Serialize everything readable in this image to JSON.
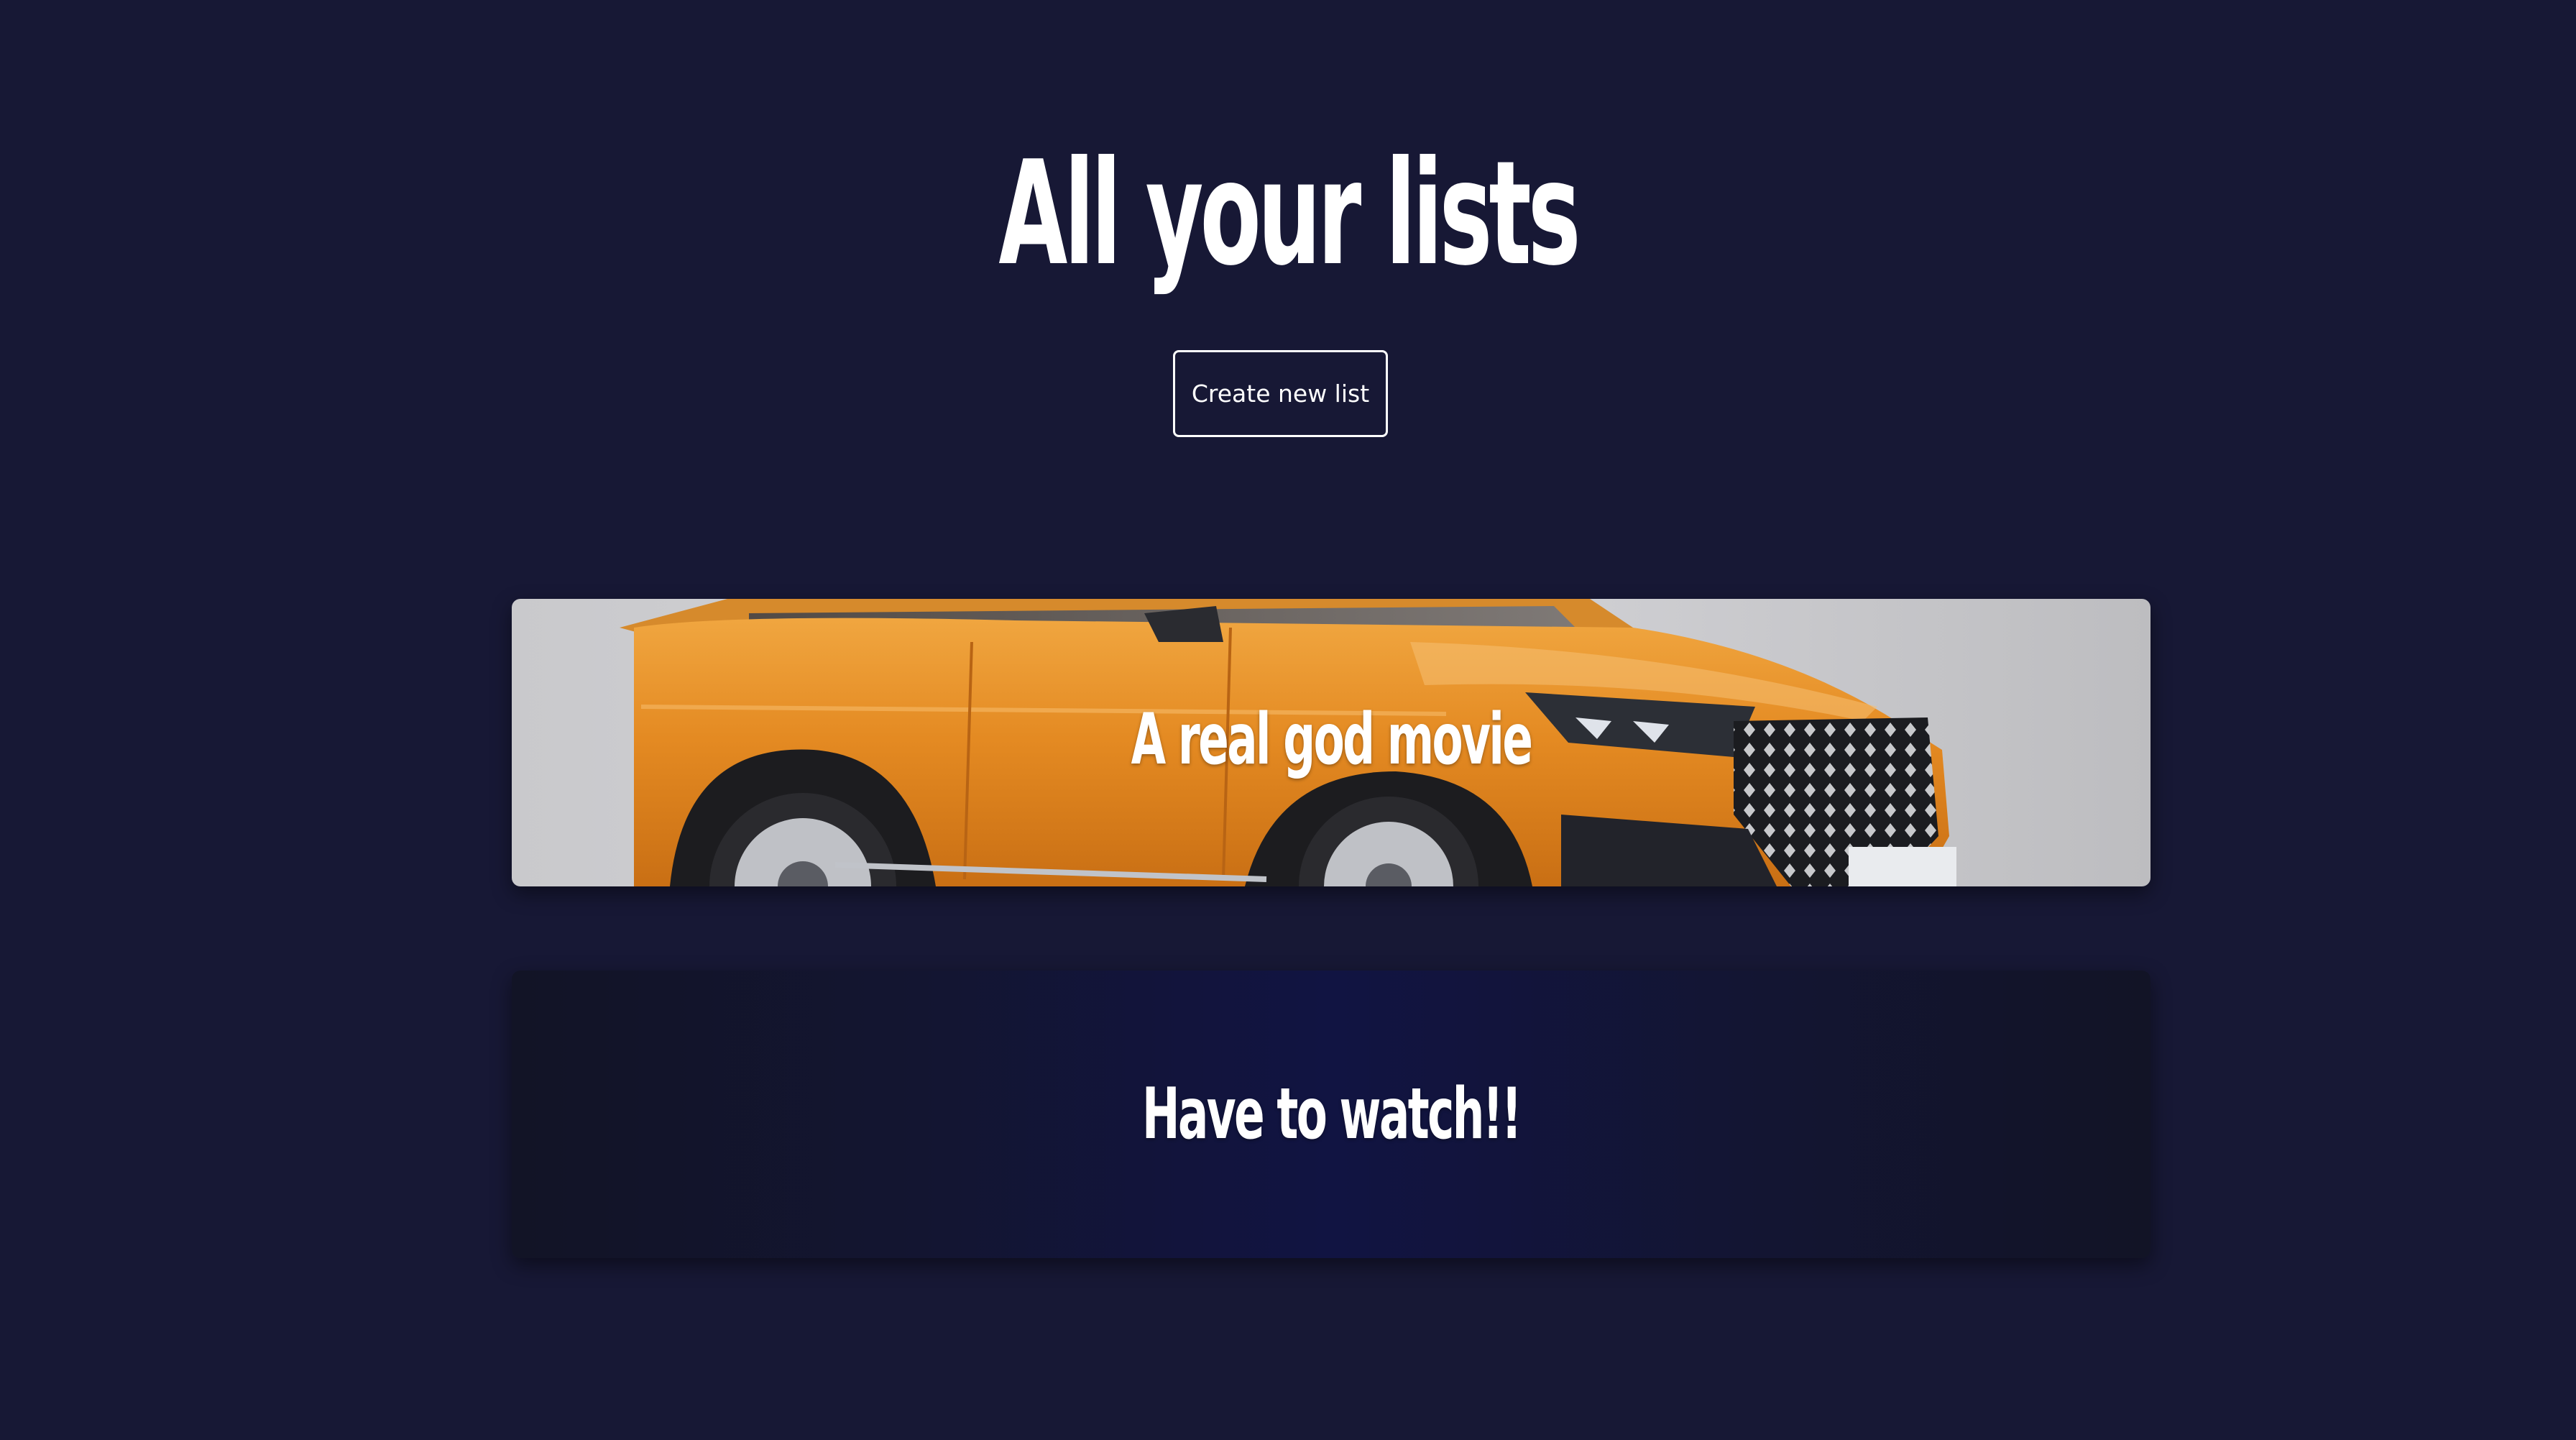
{
  "page": {
    "title": "All your lists",
    "background": "#171835"
  },
  "actions": {
    "create_label": "Create new list"
  },
  "lists": [
    {
      "name": "A real god movie",
      "cover": "orange-suv-photo"
    },
    {
      "name": "Have to watch!!",
      "cover": "dark-navy-gradient"
    }
  ]
}
